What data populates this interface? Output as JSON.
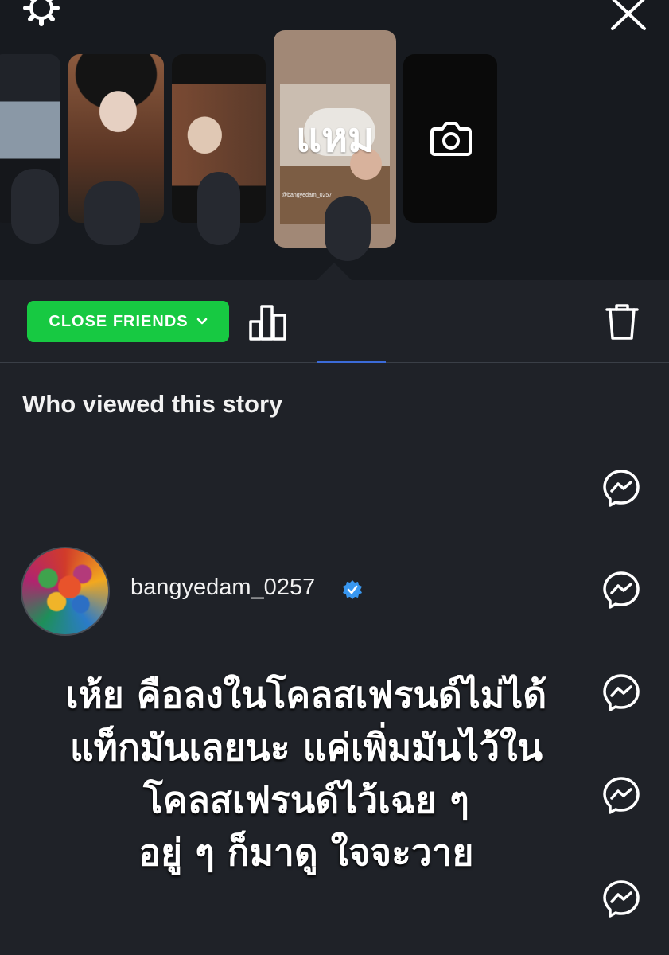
{
  "header": {
    "icons": [
      "gear-icon",
      "close-icon"
    ]
  },
  "stories": {
    "active_overlay_text": "แหม",
    "active_handle": "@bangyedam_0257",
    "new_story_icon": "camera-icon"
  },
  "toolbar": {
    "audience_label": "CLOSE FRIENDS",
    "audience_color": "#17c942",
    "icons": [
      "bar-chart-icon",
      "trash-icon"
    ]
  },
  "viewers": {
    "heading": "Who viewed this story",
    "list": [
      {
        "username": "bangyedam_0257",
        "verified": true
      }
    ],
    "message_icon": "messenger-icon"
  },
  "caption": {
    "lines": [
      "เห้ย คือลงในโคลสเฟรนด์ไม่ได้",
      "แท็กมันเลยนะ แค่เพิ่มมันไว้ใน",
      "โคลสเฟรนด์ไว้เฉย ๆ",
      "อยู่ ๆ ก็มาดู ใจจะวาย"
    ]
  },
  "colors": {
    "background": "#1f2228",
    "top_panel": "#171a1f",
    "accent_blue": "#3b6bd8",
    "verified_blue": "#3897f0"
  }
}
